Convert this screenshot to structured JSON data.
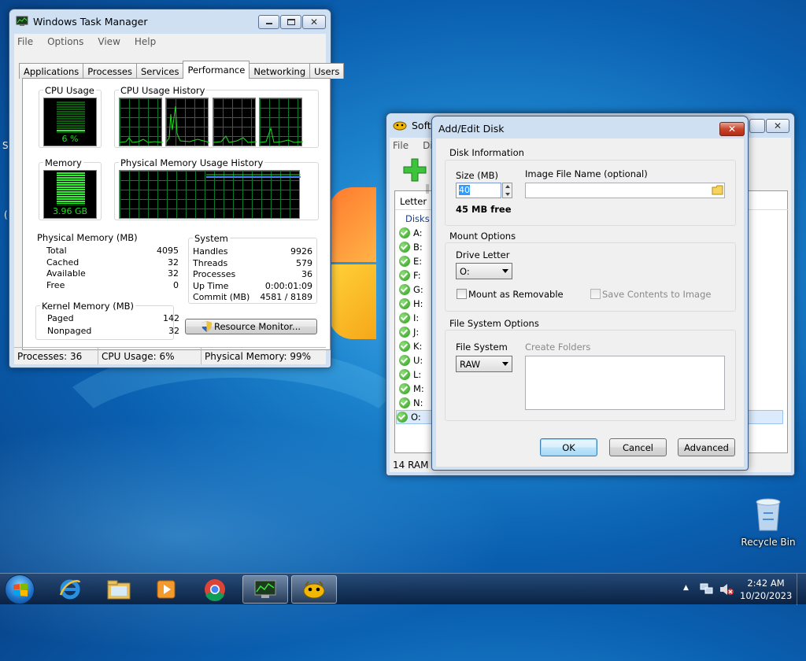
{
  "desktop": {
    "recycle_bin_label": "Recycle Bin",
    "left_edge_chars": [
      "S",
      "("
    ]
  },
  "taskmgr": {
    "title": "Windows Task Manager",
    "menu": [
      "File",
      "Options",
      "View",
      "Help"
    ],
    "tabs": [
      "Applications",
      "Processes",
      "Services",
      "Performance",
      "Networking",
      "Users"
    ],
    "active_tab": "Performance",
    "cpu_usage_title": "CPU Usage",
    "cpu_usage_value": "6 %",
    "cpu_usage_fraction": 0.06,
    "cpu_history_title": "CPU Usage History",
    "memory_title": "Memory",
    "memory_value": "3.96 GB",
    "memory_fraction": 0.99,
    "phys_history_title": "Physical Memory Usage History",
    "physical_memory": {
      "title": "Physical Memory (MB)",
      "rows": [
        {
          "label": "Total",
          "value": "4095"
        },
        {
          "label": "Cached",
          "value": "32"
        },
        {
          "label": "Available",
          "value": "32"
        },
        {
          "label": "Free",
          "value": "0"
        }
      ]
    },
    "system": {
      "title": "System",
      "rows": [
        {
          "label": "Handles",
          "value": "9926"
        },
        {
          "label": "Threads",
          "value": "579"
        },
        {
          "label": "Processes",
          "value": "36"
        },
        {
          "label": "Up Time",
          "value": "0:00:01:09"
        },
        {
          "label": "Commit (MB)",
          "value": "4581 / 8189"
        }
      ]
    },
    "kernel_memory": {
      "title": "Kernel Memory (MB)",
      "rows": [
        {
          "label": "Paged",
          "value": "142"
        },
        {
          "label": "Nonpaged",
          "value": "32"
        }
      ]
    },
    "resource_monitor_label": "Resource Monitor...",
    "status": {
      "processes": "Processes: 36",
      "cpu": "CPU Usage: 6%",
      "memory": "Physical Memory: 99%"
    }
  },
  "softperfect": {
    "title_partial": "SoftP",
    "menu": [
      "File",
      "Di"
    ],
    "column_letter": "Letter",
    "group_label": "Disks r",
    "drives": [
      "A:",
      "B:",
      "E:",
      "F:",
      "G:",
      "H:",
      "I:",
      "J:",
      "K:",
      "U:",
      "L:",
      "M:",
      "N:",
      "O:"
    ],
    "selected_drive": "O:",
    "status_partial": "14 RAM d"
  },
  "dialog": {
    "title": "Add/Edit Disk",
    "disk_info_title": "Disk Information",
    "size_label": "Size (MB)",
    "size_value": "40",
    "free_text": "45 MB free",
    "image_file_label": "Image File Name (optional)",
    "image_file_value": "",
    "mount_options_title": "Mount Options",
    "drive_letter_label": "Drive Letter",
    "drive_letter_value": "O:",
    "mount_removable_label": "Mount as Removable",
    "save_contents_label": "Save Contents to Image",
    "fs_options_title": "File System Options",
    "file_system_label": "File System",
    "file_system_value": "RAW",
    "create_folders_label": "Create Folders",
    "ok_label": "OK",
    "cancel_label": "Cancel",
    "advanced_label": "Advanced"
  },
  "taskbar": {
    "time": "2:42 AM",
    "date": "10/20/2023",
    "tray_arrow": "▲"
  },
  "colors": {
    "scope_green": "#1fe01f",
    "scope_grid": "#0a7a2e",
    "memory_line": "#4a7dff",
    "dialog_blue": "#1e3f8a"
  }
}
